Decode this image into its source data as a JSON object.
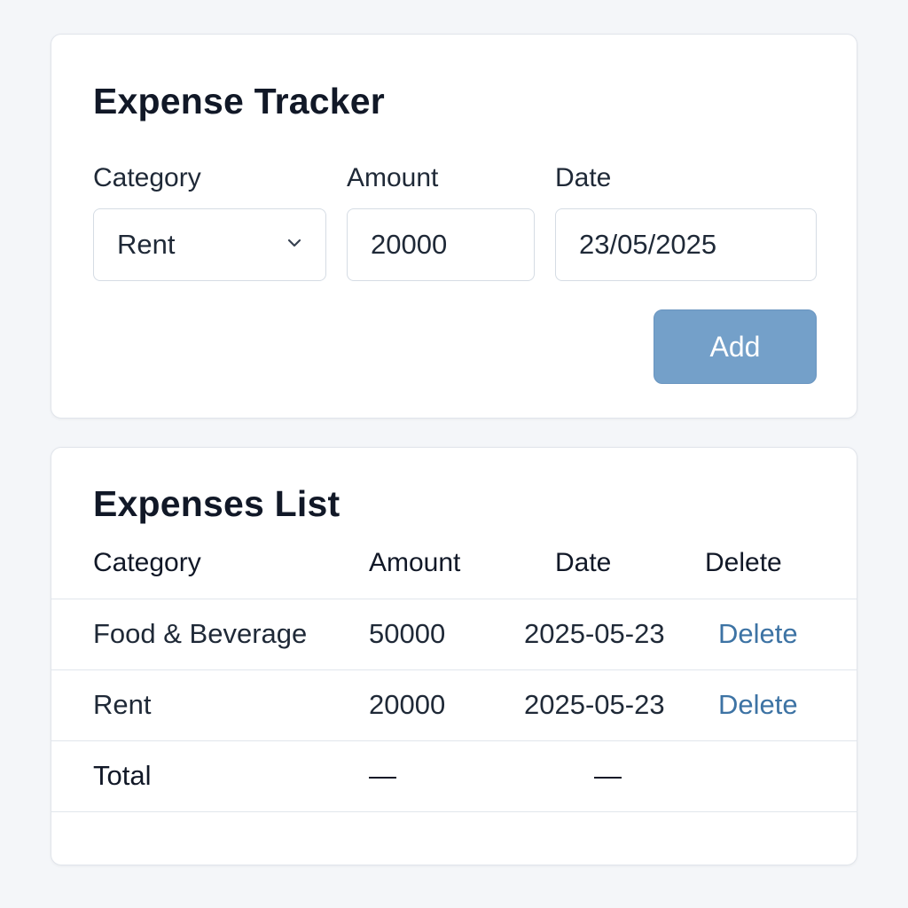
{
  "form": {
    "title": "Expense Tracker",
    "category_label": "Category",
    "category_value": "Rent",
    "amount_label": "Amount",
    "amount_value": "20000",
    "date_label": "Date",
    "date_value": "23/05/2025",
    "add_label": "Add"
  },
  "list": {
    "title": "Expenses List",
    "headers": {
      "category": "Category",
      "amount": "Amount",
      "date": "Date",
      "delete": "Delete"
    },
    "rows": [
      {
        "category": "Food & Beverage",
        "amount": "50000",
        "date": "2025-05-23",
        "delete": "Delete"
      },
      {
        "category": "Rent",
        "amount": "20000",
        "date": "2025-05-23",
        "delete": "Delete"
      }
    ],
    "total": {
      "label": "Total",
      "amount": "—",
      "date": "—"
    }
  },
  "colors": {
    "accent": "#74a0c9",
    "link": "#3d73a4",
    "background": "#f4f6f9"
  }
}
